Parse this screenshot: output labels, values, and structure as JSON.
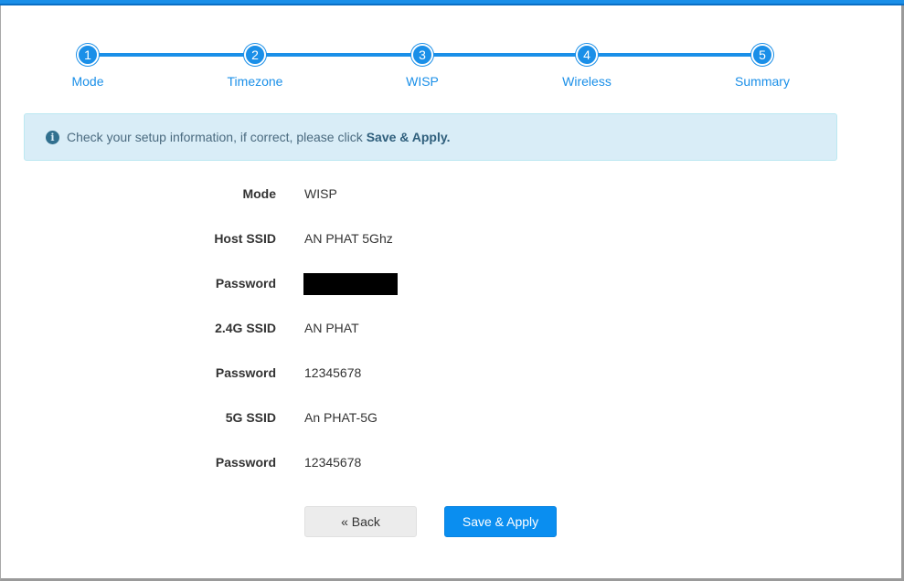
{
  "stepper": {
    "steps": [
      {
        "number": "1",
        "label": "Mode"
      },
      {
        "number": "2",
        "label": "Timezone"
      },
      {
        "number": "3",
        "label": "WISP"
      },
      {
        "number": "4",
        "label": "Wireless"
      },
      {
        "number": "5",
        "label": "Summary"
      }
    ],
    "color": "#1a8fe8"
  },
  "alert": {
    "icon": "info-icon",
    "text": "Check your setup information, if correct, please click",
    "emphasis": "Save & Apply."
  },
  "summary": {
    "rows": [
      {
        "label": "Mode",
        "value": "WISP"
      },
      {
        "label": "Host SSID",
        "value": "AN PHAT 5Ghz"
      },
      {
        "label": "Password",
        "value": ""
      },
      {
        "label": "2.4G SSID",
        "value": "AN PHAT"
      },
      {
        "label": "Password",
        "value": "12345678"
      },
      {
        "label": "5G SSID",
        "value": "An PHAT-5G"
      },
      {
        "label": "Password",
        "value": "12345678"
      }
    ]
  },
  "buttons": {
    "back_label": "« Back",
    "apply_label": "Save & Apply"
  }
}
